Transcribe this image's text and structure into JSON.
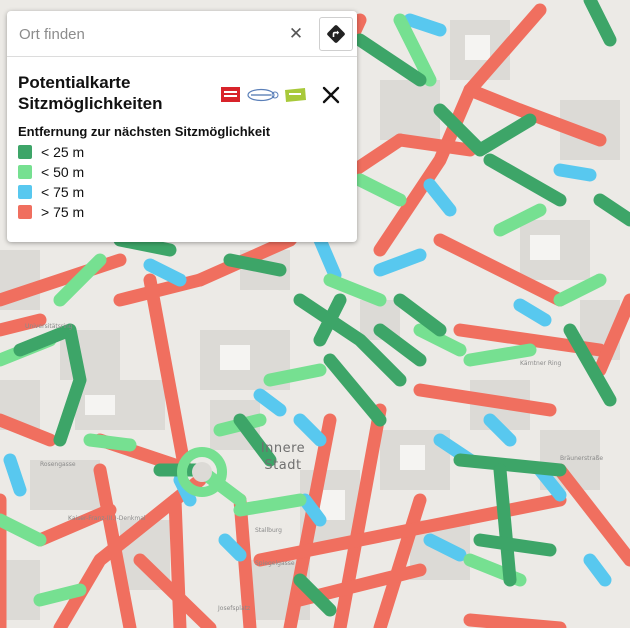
{
  "search": {
    "placeholder": "Ort finden",
    "clear_icon": "close-icon",
    "route_icon": "route-direction-icon"
  },
  "panel": {
    "title_line1": "Potentialkarte",
    "title_line2": "Sitzmöglichkeiten",
    "close_icon": "close-icon",
    "logos": [
      "partner-logo-red",
      "partner-logo-blue",
      "partner-logo-green"
    ]
  },
  "legend": {
    "title": "Entfernung zur nächsten Sitzmöglichkeit",
    "items": [
      {
        "label": "< 25 m",
        "color": "#3da568"
      },
      {
        "label": "< 50 m",
        "color": "#76e091"
      },
      {
        "label": "< 75 m",
        "color": "#58c8ef"
      },
      {
        "label": "> 75 m",
        "color": "#f06f5f"
      }
    ]
  },
  "map": {
    "district_line1": "Innere",
    "district_line2": "Stadt",
    "street_labels": [
      "Kaiser-Franz-(II.)-Denkmal",
      "Rosengasse",
      "Universitätsring",
      "Kärntner Ring",
      "Stallburg",
      "Spiegelgasse",
      "Bräunerstraße",
      "Josefsplatz"
    ]
  }
}
